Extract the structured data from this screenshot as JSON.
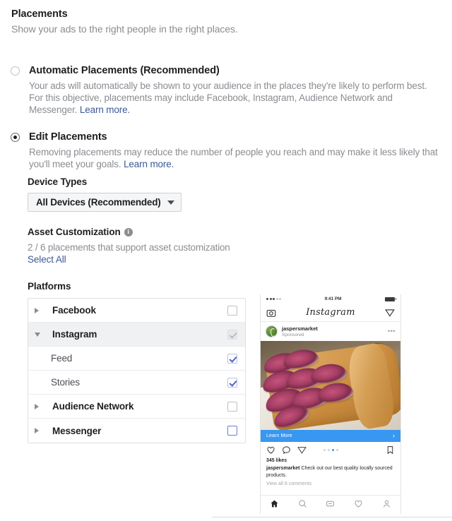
{
  "header": {
    "title": "Placements",
    "subtitle": "Show your ads to the right people in the right places."
  },
  "options": [
    {
      "label": "Automatic Placements (Recommended)",
      "description": "Your ads will automatically be shown to your audience in the places they're likely to perform best. For this objective, placements may include Facebook, Instagram, Audience Network and Messenger.",
      "link": "Learn more.",
      "selected": false
    },
    {
      "label": "Edit Placements",
      "description": "Removing placements may reduce the number of people you reach and may make it less likely that you'll meet your goals.",
      "link": "Learn more.",
      "selected": true
    }
  ],
  "device_types": {
    "label": "Device Types",
    "selected": "All Devices (Recommended)",
    "caret": "chevron-down-icon"
  },
  "asset_customization": {
    "label": "Asset Customization",
    "info_icon": "info-icon",
    "count_text": "2 / 6 placements that support asset customization",
    "select_all": "Select All"
  },
  "platforms": {
    "label": "Platforms",
    "rows": [
      {
        "name": "Facebook",
        "level": 0,
        "expanded": false,
        "checkbox": "unchecked",
        "twisty": "chevron-right-icon"
      },
      {
        "name": "Instagram",
        "level": 0,
        "expanded": true,
        "checkbox": "muted-checked",
        "twisty": "chevron-down-icon"
      },
      {
        "name": "Feed",
        "level": 1,
        "expanded": null,
        "checkbox": "checked",
        "twisty": "none"
      },
      {
        "name": "Stories",
        "level": 1,
        "expanded": null,
        "checkbox": "checked",
        "twisty": "none"
      },
      {
        "name": "Audience Network",
        "level": 0,
        "expanded": false,
        "checkbox": "unchecked",
        "twisty": "chevron-right-icon"
      },
      {
        "name": "Messenger",
        "level": 0,
        "expanded": false,
        "checkbox": "unchecked-focused",
        "twisty": "chevron-right-icon"
      }
    ]
  },
  "preview": {
    "status_bar": {
      "time": "9:41 PM",
      "signal_icon": "signal-dots-icon",
      "battery_icon": "battery-icon"
    },
    "app_bar": {
      "wordmark": "Instagram",
      "camera_icon": "camera-icon",
      "send_icon": "paper-plane-icon"
    },
    "post": {
      "account": "jaspersmarket",
      "sponsored_label": "Sponsored",
      "more_icon": "more-dots-icon",
      "avatar": "profile-avatar",
      "image": "fig-tart-photo"
    },
    "cta": {
      "label": "Learn More",
      "arrow_icon": "chevron-right-icon"
    },
    "actions": {
      "like_icon": "heart-icon",
      "comment_icon": "comment-icon",
      "share_icon": "paper-plane-icon",
      "save_icon": "bookmark-icon",
      "pager_dots": 4,
      "pager_active_index": 2
    },
    "meta": {
      "likes": "345 likes",
      "caption_author": "jaspersmarket",
      "caption_text": "Check out our best quality locally sourced products.",
      "comments": "View all 8 comments"
    },
    "tabbar": {
      "home_icon": "home-icon",
      "search_icon": "search-icon",
      "explore_icon": "explore-icon",
      "activity_icon": "heart-icon",
      "profile_icon": "person-icon"
    }
  },
  "colors": {
    "link": "#3b5998",
    "accent_blue": "#3897f0",
    "checkbox_checked": "#4c63c9",
    "muted_text": "#8a8d91"
  }
}
